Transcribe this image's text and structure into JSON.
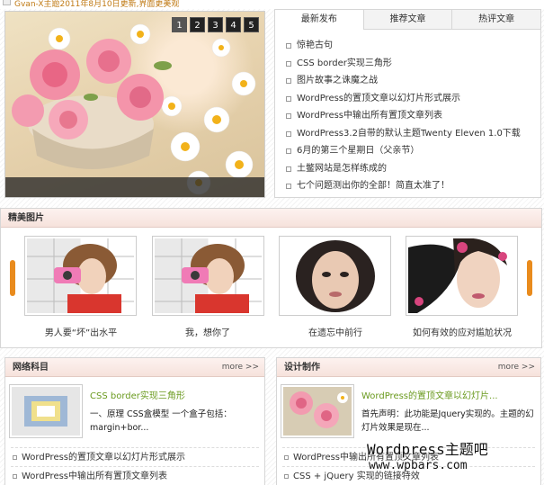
{
  "top_notice": "Gvan-X主题2011年8月10日更新,界面更美观",
  "slider": {
    "pages": [
      "1",
      "2",
      "3",
      "4",
      "5"
    ],
    "active_page": "1"
  },
  "tabs": {
    "items": [
      "最新发布",
      "推荐文章",
      "热评文章"
    ],
    "active": "最新发布",
    "list": [
      "惊艳古句",
      "CSS border实现三角形",
      "图片故事之诛魔之战",
      "WordPress的置顶文章以幻灯片形式展示",
      "WordPress中输出所有置顶文章列表",
      "WordPress3.2自带的默认主题Twenty Eleven 1.0下载",
      "6月的第三个星期日（父亲节）",
      "土鳖网站是怎样练成的",
      "七个问题测出你的全部！简直太准了！"
    ]
  },
  "gallery": {
    "title": "精美图片",
    "items": [
      {
        "caption": "男人要“坏”出水平"
      },
      {
        "caption": "我，想你了"
      },
      {
        "caption": "在遗忘中前行"
      },
      {
        "caption": "如何有效的应对尴尬状况"
      }
    ]
  },
  "left_column": {
    "title": "网络科目",
    "more": "more >>",
    "feature_title": "CSS border实现三角形",
    "feature_excerpt": "一、原理 CSS盒模型 一个盒子包括：margin+bor...",
    "list": [
      "WordPress的置顶文章以幻灯片形式展示",
      "WordPress中输出所有置顶文章列表"
    ]
  },
  "right_column": {
    "title": "设计制作",
    "more": "more >>",
    "feature_title": "WordPress的置顶文章以幻灯片...",
    "feature_excerpt": "首先声明：此功能是Jquery实现的。主题的幻灯片效果是现在...",
    "list": [
      "WordPress中输出所有置顶文章列表",
      "CSS + jQuery 实现的链接特效"
    ]
  },
  "watermark": {
    "line1": "Wordpress主题吧",
    "line2": "www.wpbars.com"
  },
  "colors": {
    "accent_orange": "#e98b1d",
    "feature_green": "#6a9a1e",
    "notice_orange": "#c07a14"
  }
}
